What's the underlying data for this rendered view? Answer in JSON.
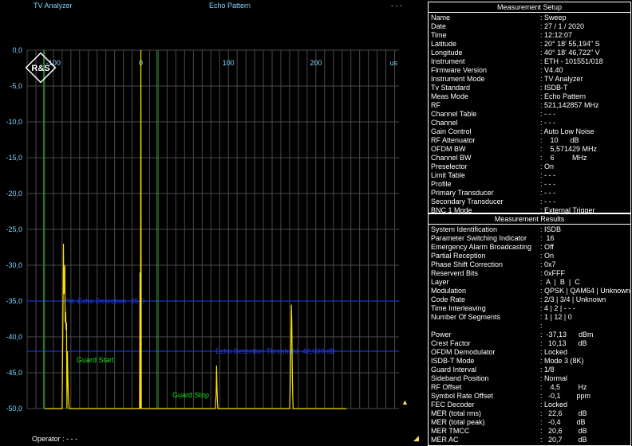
{
  "header": {
    "app_title": "TV Analyzer",
    "view_title": "Echo Pattern",
    "status": "- - -"
  },
  "chart_data": {
    "type": "line",
    "title": "",
    "xlabel": "us",
    "ylabel": "",
    "xlim": [
      -130,
      295
    ],
    "ylim": [
      -50,
      0
    ],
    "x_ticks": [
      -100,
      0,
      100,
      200
    ],
    "x_tick_labels": [
      "-100",
      "0",
      "100",
      "200"
    ],
    "y_ticks": [
      0,
      -5,
      -10,
      -15,
      -20,
      -25,
      -30,
      -35,
      -40,
      -45,
      -50
    ],
    "y_tick_labels": [
      "0,0",
      "-5,0",
      "-10,0",
      "-15,0",
      "-20,0",
      "-25,0",
      "-30,0",
      "-35,0",
      "-40,0",
      "-45,0",
      "-50,0"
    ],
    "grid": true,
    "series": [
      {
        "color": "#ffe000",
        "x": [
          -110,
          -90,
          -89,
          -88.5,
          -88,
          -87,
          -86.5,
          -86,
          -85.5,
          -85,
          -84.5,
          -84,
          -83,
          -82,
          -1.5,
          -1,
          -0.5,
          0,
          0.5,
          1,
          1.5,
          85,
          86,
          86.5,
          87,
          87.5,
          88,
          170,
          171,
          172,
          172.5,
          173,
          173.5,
          174,
          175,
          235
        ],
        "y": [
          -50,
          -50,
          -36,
          -27,
          -34,
          -30,
          -38,
          -36.5,
          -39,
          -38,
          -50,
          -42,
          -48,
          -50,
          -50,
          -31,
          -50,
          0,
          -50,
          -50,
          -50,
          -50,
          -48,
          -44,
          -47,
          -49,
          -50,
          -50,
          -46,
          -35.5,
          -38,
          -44,
          -48,
          -50,
          -50,
          -50
        ]
      }
    ],
    "threshold_lines": [
      {
        "label": "Echo Detection Threshold",
        "label_visible": "Pre-Echo Detection -35,0",
        "y": -35
      },
      {
        "label": "Echo Detection Threshold -42,000 dB",
        "y": -42
      }
    ],
    "guard_lines": [
      {
        "label": "Guard Start",
        "x": -111
      },
      {
        "label": "Guard Stop",
        "x": 18.5
      }
    ]
  },
  "setup": {
    "title": "Measurement Setup",
    "rows": [
      {
        "k": "Name",
        "v": ": Sweep"
      },
      {
        "k": "Date",
        "v": ": 27 / 1 / 2020"
      },
      {
        "k": "Time",
        "v": ": 12:12:07"
      },
      {
        "k": "Latitude",
        "v": ": 20° 18' 55,194\" S"
      },
      {
        "k": "Longitude",
        "v": ": 40° 18' 46,722\" V"
      },
      {
        "k": "Instrument",
        "v": ": ETH - 101551/018"
      },
      {
        "k": "Firmware Version",
        "v": ": V4.40"
      },
      {
        "k": "Instrument Mode",
        "v": ": TV Analyzer"
      },
      {
        "k": "Tv Standard",
        "v": ": ISDB-T"
      },
      {
        "k": "Meas Mode",
        "v": ": Echo Pattern"
      },
      {
        "k": "RF",
        "v": ": 521,142857 MHz"
      },
      {
        "k": "Channel Table",
        "v": ": - - -"
      },
      {
        "k": "Channel",
        "v": ": - - -"
      },
      {
        "k": "Gain Control",
        "v": ": Auto Low Noise"
      },
      {
        "k": "RF Attenuator",
        "v": ":    10      dB"
      },
      {
        "k": "OFDM BW",
        "v": ":    5,571429 MHz"
      },
      {
        "k": "Channel BW",
        "v": ":    6         MHz"
      },
      {
        "k": "Preselector",
        "v": ": On"
      },
      {
        "k": "Limit Table",
        "v": ": - - -"
      },
      {
        "k": "Profile",
        "v": ": - - -"
      },
      {
        "k": "Primary Transducer",
        "v": ": - - -"
      },
      {
        "k": "Secondary Transducer",
        "v": ": - - -"
      },
      {
        "k": "BNC 1 Mode",
        "v": ": External Trigger"
      }
    ]
  },
  "results": {
    "title": "Measurement Results",
    "rows": [
      {
        "k": "System Identification",
        "v": ": ISDB"
      },
      {
        "k": "Parameter Switching Indicator",
        "v": ":  16"
      },
      {
        "k": "Emergency Alarm Broadcasting",
        "v": ": Off"
      },
      {
        "k": "Partial Reception",
        "v": ": On"
      },
      {
        "k": "Phase Shift Correction",
        "v": ": 0x7"
      },
      {
        "k": "Reserverd Bits",
        "v": ": 0xFFF"
      },
      {
        "k": "Layer",
        "v": ":  A  |  B  |  C"
      },
      {
        "k": "Modulation",
        "v": ": QPSK | QAM64 | Unknown"
      },
      {
        "k": "Code Rate",
        "v": ": 2/3 | 3/4 | Unknown"
      },
      {
        "k": "Time Interleaving",
        "v": ": 4 | 2 | - - -"
      },
      {
        "k": "Number Of Segments",
        "v": ": 1 | 12 | 0"
      },
      {
        "k": "",
        "v": ":"
      },
      {
        "k": "Power",
        "v": ":  -37,13      dBm"
      },
      {
        "k": "Crest Factor",
        "v": ":   10,13      dB"
      },
      {
        "k": "OFDM Demodulator",
        "v": ": Locked"
      },
      {
        "k": "ISDB-T Mode",
        "v": ": Mode 3 (8K)"
      },
      {
        "k": "Guard Interval",
        "v": ": 1/8"
      },
      {
        "k": "  Sideband Position",
        "v": ": Normal"
      },
      {
        "k": "  RF Offset",
        "v": ":    4,5         Hz"
      },
      {
        "k": "  Symbol Rate Offset",
        "v": ":   -0,1        ppm"
      },
      {
        "k": "FEC Decoder",
        "v": ": Locked"
      },
      {
        "k": "  MER (total rms)",
        "v": ":   22,6        dB"
      },
      {
        "k": "  MER (total peak)",
        "v": ":   -0,4        dB"
      },
      {
        "k": "  MER TMCC",
        "v": ":   20,6        dB"
      },
      {
        "k": "  MER AC",
        "v": ":   20,7        dB"
      }
    ]
  },
  "footer": {
    "operator": "Operator : - - -"
  },
  "logo": {
    "text": "R&S"
  }
}
